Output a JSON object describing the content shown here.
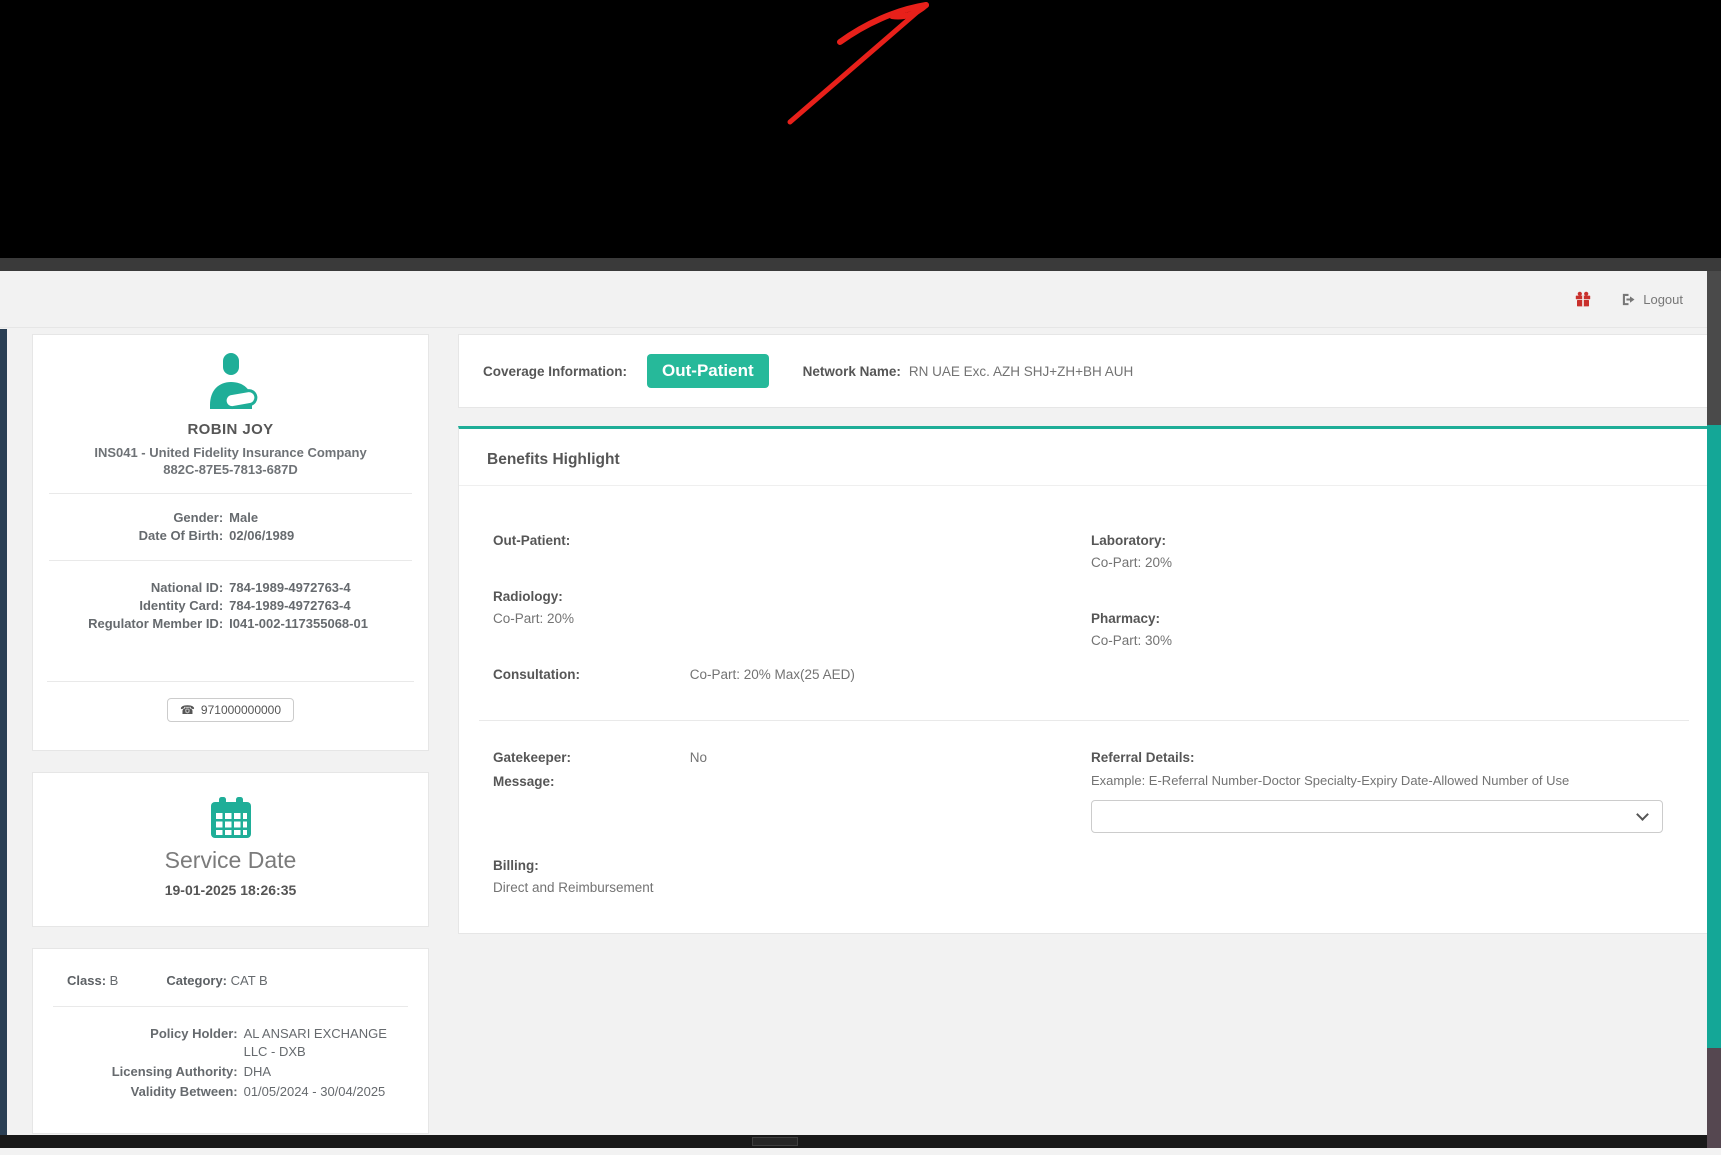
{
  "colors": {
    "accent_teal": "#26b99a",
    "teal_icon": "#1fae98",
    "sidebar_sliver": "#2a3f54",
    "arrow_red": "#e8201a",
    "gift_red": "#c9302c",
    "page_bg": "#f2f2f2",
    "banner_black": "#000000"
  },
  "topbar": {
    "logout_label": "Logout"
  },
  "patient_card": {
    "name": "ROBIN JOY",
    "insurer": "INS041 - United Fidelity Insurance Company",
    "member_code": "882C-87E5-7813-687D",
    "demographics": [
      {
        "label": "Gender:",
        "value": "Male"
      },
      {
        "label": "Date Of Birth:",
        "value": "02/06/1989"
      }
    ],
    "ids": [
      {
        "label": "National ID:",
        "value": "784-1989-4972763-4"
      },
      {
        "label": "Identity Card:",
        "value": "784-1989-4972763-4"
      },
      {
        "label": "Regulator Member ID:",
        "value": "I041-002-117355068-01"
      }
    ],
    "phone": "971000000000"
  },
  "service_card": {
    "title": "Service Date",
    "datetime": "19-01-2025 18:26:35"
  },
  "policy_card": {
    "class_label": "Class:",
    "class_value": "B",
    "category_label": "Category:",
    "category_value": "CAT B",
    "rows": [
      {
        "label": "Policy Holder:",
        "value": "AL ANSARI EXCHANGE LLC - DXB"
      },
      {
        "label": "Licensing Authority:",
        "value": "DHA"
      },
      {
        "label": "Validity Between:",
        "value": "01/05/2024 - 30/04/2025"
      }
    ]
  },
  "coverage": {
    "label": "Coverage Information:",
    "badge": "Out-Patient",
    "network_label": "Network Name:",
    "network_value": "RN UAE Exc. AZH SHJ+ZH+BH AUH"
  },
  "benefits": {
    "title": "Benefits Highlight",
    "out_patient_label": "Out-Patient:",
    "radiology_label": "Radiology:",
    "radiology_value": "Co-Part: 20%",
    "consultation_label": "Consultation:",
    "consultation_value": "Co-Part: 20% Max(25 AED)",
    "laboratory_label": "Laboratory:",
    "laboratory_value": "Co-Part: 20%",
    "pharmacy_label": "Pharmacy:",
    "pharmacy_value": "Co-Part: 30%",
    "gatekeeper_label": "Gatekeeper:",
    "gatekeeper_value": "No",
    "message_label": "Message:",
    "referral_label": "Referral Details:",
    "referral_example": "Example: E-Referral Number-Doctor Specialty-Expiry Date-Allowed Number of Use",
    "billing_label": "Billing:",
    "billing_value": "Direct and Reimbursement"
  }
}
